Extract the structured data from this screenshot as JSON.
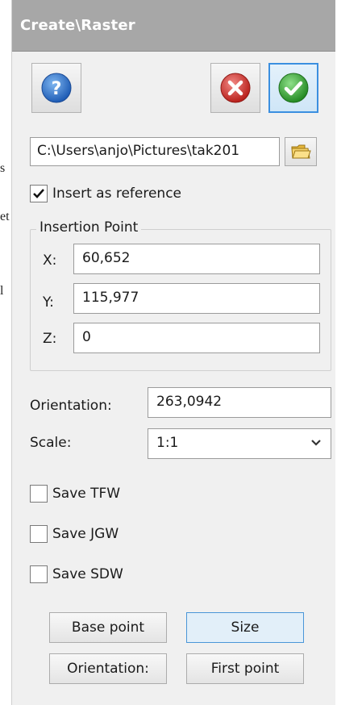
{
  "background_fragments": [
    "s",
    "et",
    "l"
  ],
  "title": "Create\\Raster",
  "toolbar": {
    "help_icon": "help-icon",
    "cancel_icon": "cancel-icon",
    "ok_icon": "ok-icon"
  },
  "file": {
    "path": "C:\\Users\\anjo\\Pictures\\tak201",
    "browse_icon": "folder-open-icon"
  },
  "insert_as_reference": {
    "label": "Insert as reference",
    "checked": true
  },
  "insertion_point": {
    "legend": "Insertion Point",
    "x_label": "X:",
    "x_value": "60,652",
    "y_label": "Y:",
    "y_value": "115,977",
    "z_label": "Z:",
    "z_value": "0"
  },
  "orientation": {
    "label": "Orientation:",
    "value": "263,0942"
  },
  "scale": {
    "label": "Scale:",
    "value": "1:1"
  },
  "save_options": [
    {
      "label": "Save TFW",
      "checked": false
    },
    {
      "label": "Save JGW",
      "checked": false
    },
    {
      "label": "Save SDW",
      "checked": false
    }
  ],
  "buttons": {
    "base_point": "Base point",
    "size": "Size",
    "orientation": "Orientation:",
    "first_point": "First point"
  },
  "colors": {
    "titlebar": "#a7a7a7",
    "accent_blue": "#3b8fe0",
    "cancel_red": "#d0312d",
    "ok_green": "#3aa53a",
    "help_blue": "#2e6fc4"
  }
}
